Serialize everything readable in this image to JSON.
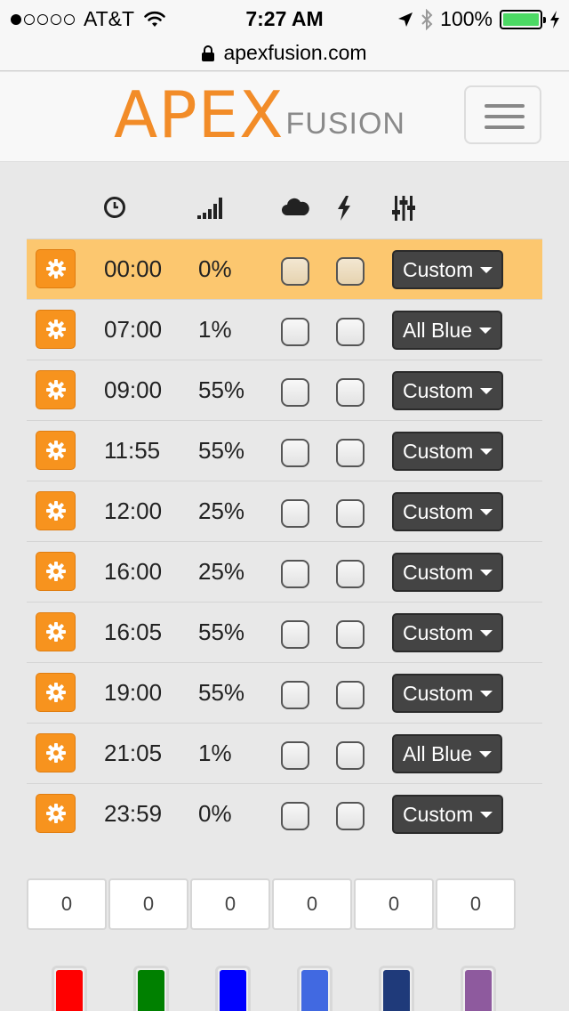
{
  "status_bar": {
    "signal_dots_filled": 1,
    "signal_dots_total": 5,
    "carrier": "AT&T",
    "time": "7:27 AM",
    "battery": "100%"
  },
  "browser": {
    "url": "apexfusion.com"
  },
  "header": {
    "logo_main": "APEX",
    "logo_sub": "FUSION"
  },
  "table": {
    "columns": [
      "clock-icon",
      "signal-icon",
      "cloud-icon",
      "lightning-icon",
      "sliders-icon"
    ],
    "rows": [
      {
        "time": "00:00",
        "intensity": "0%",
        "cloud": false,
        "lightning": false,
        "profile": "Custom",
        "highlighted": true
      },
      {
        "time": "07:00",
        "intensity": "1%",
        "cloud": false,
        "lightning": false,
        "profile": "All Blue",
        "highlighted": false
      },
      {
        "time": "09:00",
        "intensity": "55%",
        "cloud": false,
        "lightning": false,
        "profile": "Custom",
        "highlighted": false
      },
      {
        "time": "11:55",
        "intensity": "55%",
        "cloud": false,
        "lightning": false,
        "profile": "Custom",
        "highlighted": false
      },
      {
        "time": "12:00",
        "intensity": "25%",
        "cloud": false,
        "lightning": false,
        "profile": "Custom",
        "highlighted": false
      },
      {
        "time": "16:00",
        "intensity": "25%",
        "cloud": false,
        "lightning": false,
        "profile": "Custom",
        "highlighted": false
      },
      {
        "time": "16:05",
        "intensity": "55%",
        "cloud": false,
        "lightning": false,
        "profile": "Custom",
        "highlighted": false
      },
      {
        "time": "19:00",
        "intensity": "55%",
        "cloud": false,
        "lightning": false,
        "profile": "Custom",
        "highlighted": false
      },
      {
        "time": "21:05",
        "intensity": "1%",
        "cloud": false,
        "lightning": false,
        "profile": "All Blue",
        "highlighted": false
      },
      {
        "time": "23:59",
        "intensity": "0%",
        "cloud": false,
        "lightning": false,
        "profile": "Custom",
        "highlighted": false
      }
    ]
  },
  "channels": {
    "values": [
      "0",
      "0",
      "0",
      "0",
      "0",
      "0"
    ]
  },
  "swatches": {
    "colors": [
      "#ff0000",
      "#008000",
      "#0000ff",
      "#4169e1",
      "#1f3a7a",
      "#8e5a9e"
    ]
  },
  "colors": {
    "accent": "#f7931e",
    "highlight_row": "#fcc76f",
    "dropdown_bg": "#444444"
  }
}
